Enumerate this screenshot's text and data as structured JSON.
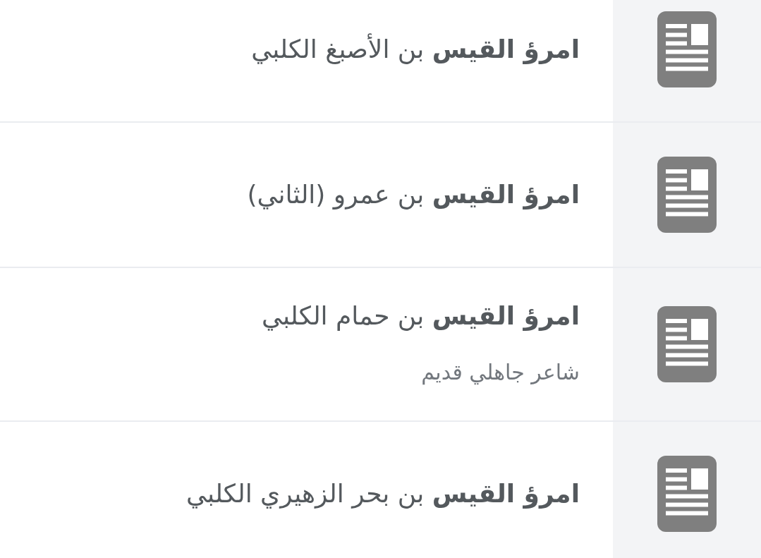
{
  "results": [
    {
      "title": "**امرؤ القيس** بن الأصبغ الكلبي"
    },
    {
      "title": "**امرؤ القيس** بن عمرو (الثاني)"
    },
    {
      "title": "**امرؤ القيس** بن حمام الكلبي",
      "description": "شاعر جاهلي قديم"
    },
    {
      "title": "**امرؤ القيس** بن بحر الزهيري الكلبي"
    }
  ]
}
